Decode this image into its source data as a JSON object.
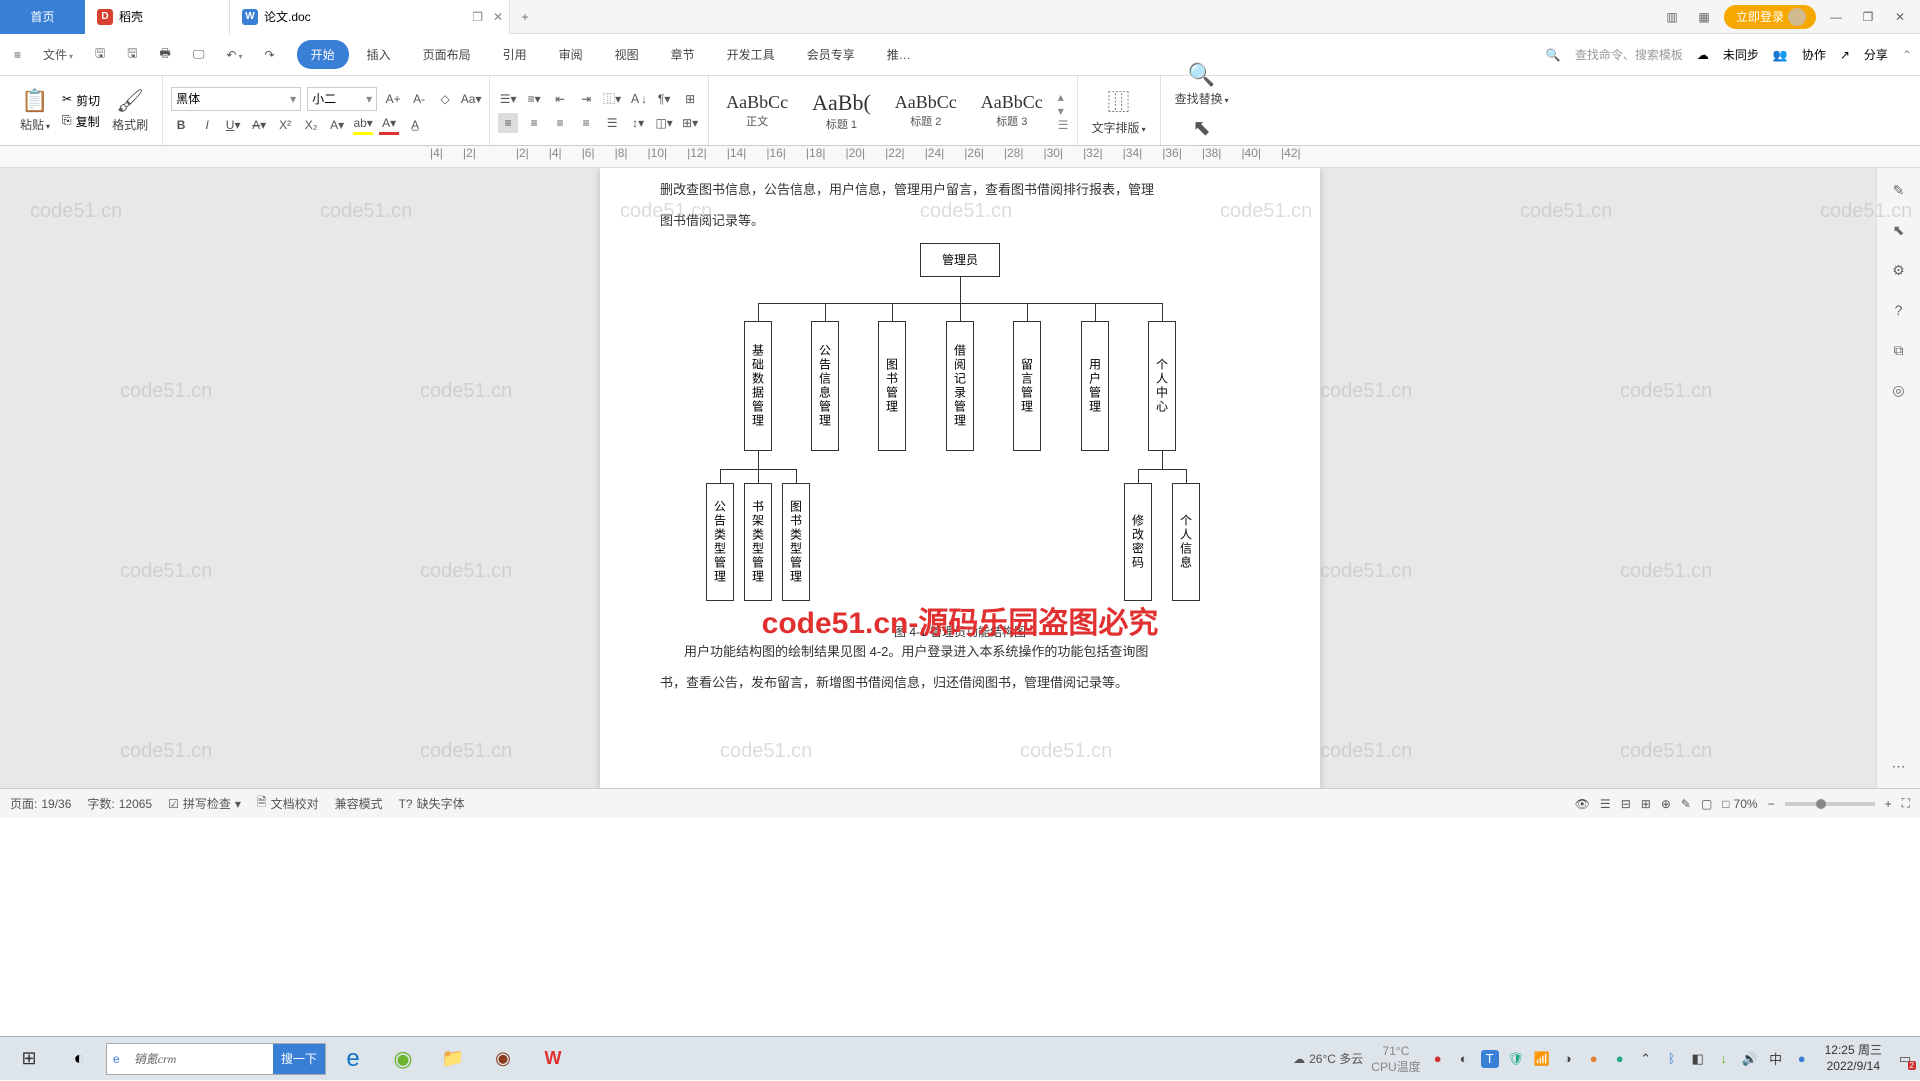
{
  "tabs": {
    "home": "首页",
    "docker": "稻壳",
    "active": "论文.doc",
    "add": "+"
  },
  "titleRight": {
    "login": "立即登录"
  },
  "menuLeft": {
    "file": "文件"
  },
  "menuTabs": [
    "开始",
    "插入",
    "页面布局",
    "引用",
    "审阅",
    "视图",
    "章节",
    "开发工具",
    "会员专享",
    "推…"
  ],
  "menuRight": {
    "search": "查找命令、搜索模板",
    "unsync": "未同步",
    "collab": "协作",
    "share": "分享"
  },
  "toolbar": {
    "paste": "粘贴",
    "cut": "剪切",
    "copy": "复制",
    "formatp": "格式刷",
    "font": "黑体",
    "fontsize": "小二",
    "layout": "文字排版",
    "findrep": "查找替换",
    "select": "选择"
  },
  "styles": {
    "normal": "正文",
    "h1": "标题 1",
    "h2": "标题 2",
    "h3": "标题 3",
    "preview": "AaBbCc",
    "previewBig": "AaBb("
  },
  "ruler": [
    "|4|",
    "|2|",
    "",
    "|2|",
    "|4|",
    "|6|",
    "|8|",
    "|10|",
    "|12|",
    "|14|",
    "|16|",
    "|18|",
    "|20|",
    "|22|",
    "|24|",
    "|26|",
    "|28|",
    "|30|",
    "|32|",
    "|34|",
    "|36|",
    "|38|",
    "|40|",
    "|42|"
  ],
  "doc": {
    "para1": "删改查图书信息，公告信息，用户信息，管理用户留言，查看图书借阅排行报表，管理",
    "para1b": "图书借阅记录等。",
    "fig_root": "管理员",
    "l1": [
      "基础数据管理",
      "公告信息管理",
      "图书管理",
      "借阅记录管理",
      "留言管理",
      "用户管理",
      "个人中心"
    ],
    "l2a": [
      "公告类型管理",
      "书架类型管理",
      "图书类型管理"
    ],
    "l2b": [
      "修改密码",
      "个人信息"
    ],
    "caption": "图 4-1 管理员功能结构图",
    "para2": "用户功能结构图的绘制结果见图 4-2。用户登录进入本系统操作的功能包括查询图",
    "para2b": "书，查看公告，发布留言，新增图书借阅信息，归还借阅图书，管理借阅记录等。"
  },
  "watermark": "code51.cn",
  "watermarkMain": "code51.cn-源码乐园盗图必究",
  "status": {
    "page_label": "页面:",
    "page": "19/36",
    "word_label": "字数:",
    "words": "12065",
    "spell": "拼写检查",
    "proof": "文档校对",
    "compat": "兼容模式",
    "missfont": "缺失字体",
    "zoom": "70%"
  },
  "taskbar": {
    "search_placeholder": "销氪crm",
    "search_btn": "搜一下",
    "temp": "26°C 多云",
    "cpu": "71°C",
    "cpulabel": "CPU温度",
    "ime": "中",
    "time": "12:25 周三",
    "date": "2022/9/14"
  }
}
